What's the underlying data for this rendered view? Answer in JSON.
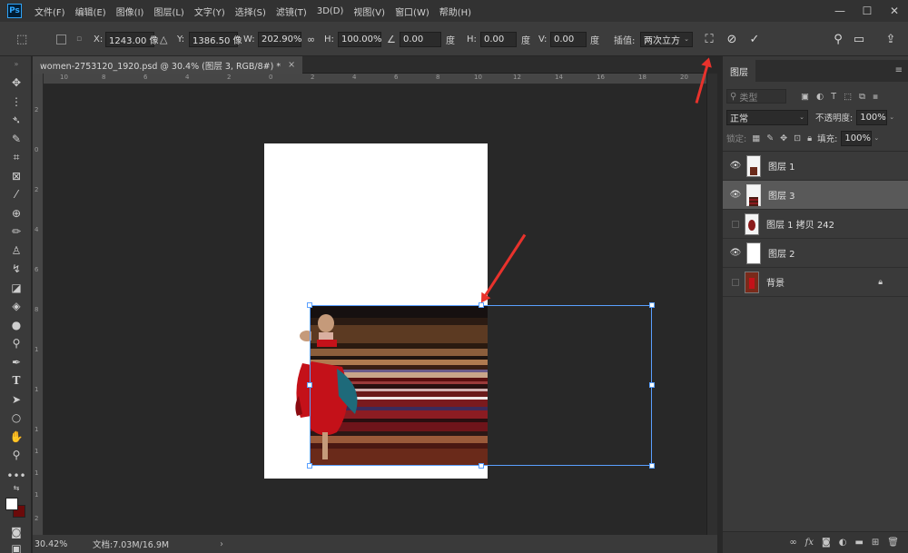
{
  "app": {
    "logo": "Ps"
  },
  "menu": [
    "文件(F)",
    "编辑(E)",
    "图像(I)",
    "图层(L)",
    "文字(Y)",
    "选择(S)",
    "滤镜(T)",
    "3D(D)",
    "视图(V)",
    "窗口(W)",
    "帮助(H)"
  ],
  "options": {
    "x_label": "X:",
    "x_value": "1243.00 像",
    "y_label": "Y:",
    "y_value": "1386.50 像",
    "w_label": "W:",
    "w_value": "202.90%",
    "h_label": "H:",
    "h_value": "100.00%",
    "angle_value": "0.00",
    "angle_unit": "度",
    "hskew_label": "H:",
    "hskew_value": "0.00",
    "hskew_unit": "度",
    "vskew_label": "V:",
    "vskew_value": "0.00",
    "vskew_unit": "度",
    "interp_label": "插值:",
    "interp_value": "两次立方"
  },
  "document": {
    "tab_title": "women-2753120_1920.psd @ 30.4% (图层 3, RGB/8#) *",
    "ruler_top_labels": [
      "10",
      "8",
      "6",
      "4",
      "2",
      "0",
      "2",
      "4",
      "6",
      "8",
      "10",
      "12",
      "14",
      "16",
      "18",
      "20"
    ],
    "ruler_left_labels": [
      "2",
      "0",
      "2",
      "4",
      "6",
      "8",
      "1",
      "1",
      "1",
      "1",
      "1",
      "1",
      "2"
    ]
  },
  "status": {
    "zoom": "30.42%",
    "doc_info": "文档:7.03M/16.9M"
  },
  "layers_panel": {
    "tab": "图层",
    "filter_kind": "类型",
    "blend_mode": "正常",
    "opacity_label": "不透明度:",
    "opacity_value": "100%",
    "lock_label": "锁定:",
    "fill_label": "填充:",
    "fill_value": "100%",
    "layers": [
      {
        "name": "图层 1",
        "visible": true,
        "selected": false
      },
      {
        "name": "图层 3",
        "visible": true,
        "selected": true
      },
      {
        "name": "图层 1 拷贝 242",
        "visible": false,
        "selected": false
      },
      {
        "name": "图层 2",
        "visible": true,
        "selected": false
      },
      {
        "name": "背景",
        "visible": false,
        "selected": false,
        "locked": true
      }
    ]
  },
  "colors": {
    "accent": "#31a8ff",
    "annotation_arrow": "#e8322c",
    "selection_box": "#5aa0ff"
  }
}
